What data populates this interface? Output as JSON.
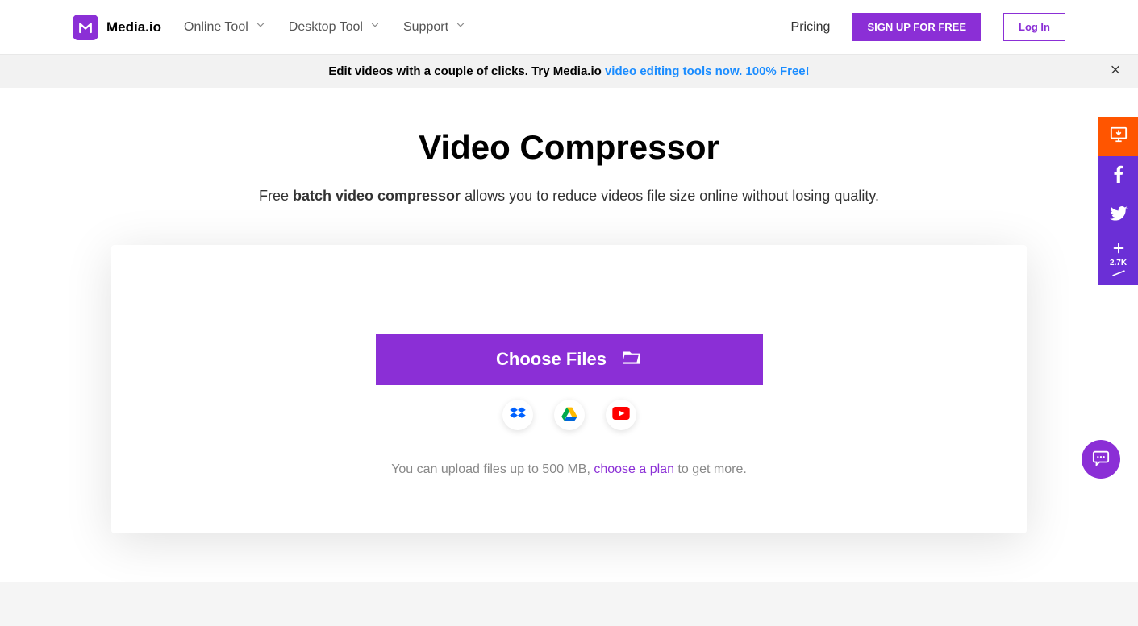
{
  "header": {
    "brand": "Media.io",
    "nav": [
      {
        "label": "Online Tool"
      },
      {
        "label": "Desktop Tool"
      },
      {
        "label": "Support"
      }
    ],
    "pricing": "Pricing",
    "signup": "SIGN UP FOR FREE",
    "login": "Log In"
  },
  "banner": {
    "text_before": "Edit videos with a couple of clicks. Try Media.io ",
    "link": "video editing tools now. 100% Free!"
  },
  "main": {
    "title": "Video Compressor",
    "subtitle_before": "Free ",
    "subtitle_bold": "batch video compressor",
    "subtitle_after": " allows you to reduce videos file size online without losing quality.",
    "choose_label": "Choose Files",
    "limit_before": "You can upload files up to 500 MB, ",
    "limit_link": "choose a plan",
    "limit_after": " to get more."
  },
  "rail": {
    "share_count": "2.7K"
  }
}
